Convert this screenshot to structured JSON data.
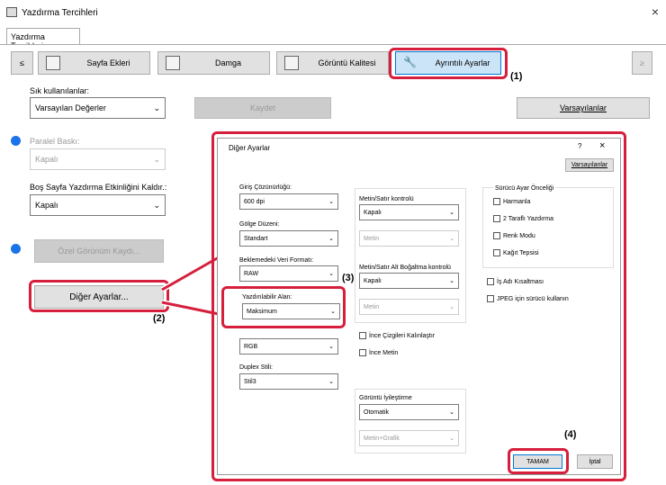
{
  "window": {
    "title": "Yazdırma Tercihleri",
    "close": "×"
  },
  "tab": "Yazdırma Tercihleri",
  "nav": {
    "left": "≤",
    "right": "≥",
    "items": [
      "Sayfa Ekleri",
      "Damga",
      "Görüntü Kalitesi",
      "Ayrıntılı Ayarlar"
    ]
  },
  "favorites": {
    "label": "Sık kullanılanlar:",
    "value": "Varsayılan Değerler",
    "save": "Kaydet",
    "defaults": "Varsayılanlar"
  },
  "parallel": {
    "label": "Paralel Baskı:",
    "value": "Kapalı"
  },
  "blank": {
    "label": "Boş Sayfa Yazdırma Etkinliğini Kaldır.:",
    "value": "Kapalı"
  },
  "custom_btn": "Özel Görünüm Kaydı...",
  "other_btn": "Diğer Ayarlar...",
  "callouts": {
    "c1": "(1)",
    "c2": "(2)",
    "c3": "(3)",
    "c4": "(4)"
  },
  "dialog": {
    "title": "Diğer Ayarlar",
    "help": "?",
    "close": "×",
    "defaults": "Varsayılanlar",
    "res_label": "Giriş Çözünürlüğü:",
    "res_value": "600 dpi",
    "shade_label": "Gölge Düzeni:",
    "shade_value": "Standart",
    "spool_label": "Beklemedeki Veri Formatı:",
    "spool_value": "RAW",
    "area_label": "Yazdırılabilir Alan:",
    "area_value": "Maksimum",
    "color_value": "RGB",
    "duplex_label": "Duplex Stili:",
    "duplex_value": "Stil3",
    "text_ctrl_label": "Metin/Satır kontrolü",
    "text_ctrl_value": "Kapalı",
    "text_ctrl_sub": "Metin",
    "thin_label": "Metin/Satır Alt Boğaltma kontrolü",
    "thin_value": "Kapalı",
    "thin_sub": "Metin",
    "thin_lines": "İnce Çizgileri Kalınlaştır",
    "thin_text": "İnce Metin",
    "improve_label": "Görüntü İyileştirme",
    "improve_value": "Otomatik",
    "improve_sub": "Metin+Grafik",
    "priority_label": "Sürücü Ayar Önceliği",
    "p1": "Harmanla",
    "p2": "2 Taraflı Yazdırma",
    "p3": "Renk Modu",
    "p4": "Kağıt Tepsisi",
    "jobname": "İş Adı Kısaltması",
    "jpeg": "JPEG için sürücü kullanın",
    "ok": "TAMAM",
    "cancel": "İptal"
  }
}
